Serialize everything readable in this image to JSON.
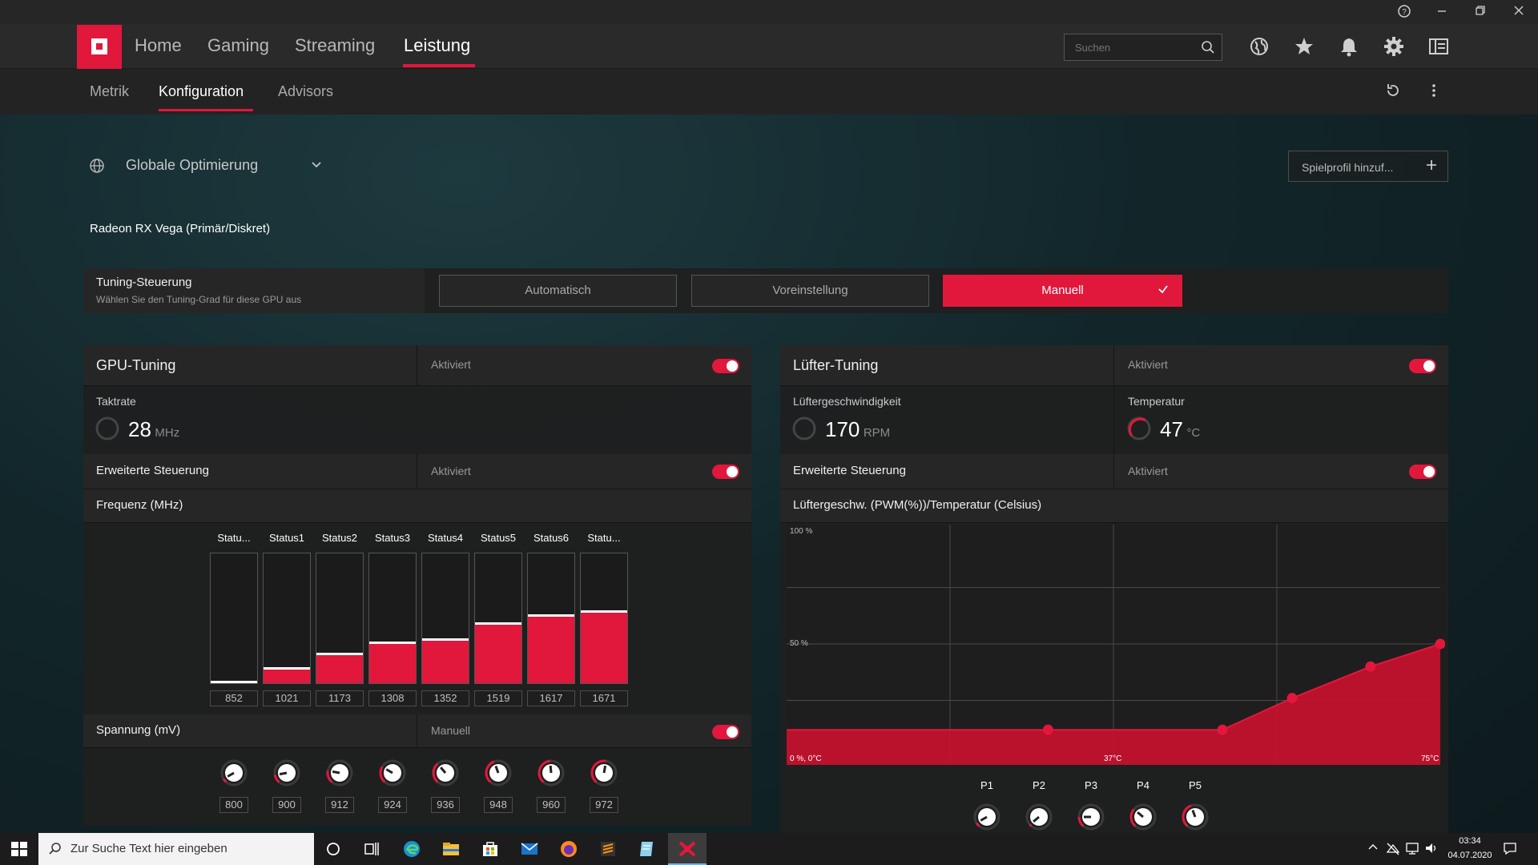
{
  "header": {
    "tabs": [
      {
        "label": "Home"
      },
      {
        "label": "Gaming"
      },
      {
        "label": "Streaming"
      },
      {
        "label": "Leistung",
        "active": true
      }
    ],
    "search_placeholder": "Suchen"
  },
  "subnav": {
    "tabs": [
      {
        "label": "Metrik"
      },
      {
        "label": "Konfiguration",
        "active": true
      },
      {
        "label": "Advisors"
      }
    ]
  },
  "profile": {
    "label": "Globale Optimierung",
    "add_button": "Spielprofil hinzuf...",
    "gpu_name": "Radeon RX Vega (Primär/Diskret)"
  },
  "tuning_control": {
    "title": "Tuning-Steuerung",
    "subtitle": "Wählen Sie den Tuning-Grad für diese GPU aus",
    "options": [
      "Automatisch",
      "Voreinstellung",
      "Manuell"
    ],
    "selected": "Manuell"
  },
  "gpu_tuning": {
    "title": "GPU-Tuning",
    "status": "Aktiviert",
    "clock_label": "Taktrate",
    "clock_value": "28",
    "clock_unit": "MHz",
    "advanced_label": "Erweiterte Steuerung",
    "advanced_status": "Aktiviert",
    "freq_label": "Frequenz (MHz)",
    "states": [
      {
        "name": "Statu...",
        "freq": "852",
        "level": 0.0,
        "voltage": "800"
      },
      {
        "name": "Status1",
        "freq": "1021",
        "level": 0.105,
        "voltage": "900"
      },
      {
        "name": "Status2",
        "freq": "1173",
        "level": 0.215,
        "voltage": "912"
      },
      {
        "name": "Status3",
        "freq": "1308",
        "level": 0.3,
        "voltage": "924"
      },
      {
        "name": "Status4",
        "freq": "1352",
        "level": 0.33,
        "voltage": "936"
      },
      {
        "name": "Status5",
        "freq": "1519",
        "level": 0.45,
        "voltage": "948"
      },
      {
        "name": "Status6",
        "freq": "1617",
        "level": 0.51,
        "voltage": "960"
      },
      {
        "name": "Statu...",
        "freq": "1671",
        "level": 0.545,
        "voltage": "972"
      }
    ],
    "voltage_label": "Spannung (mV)",
    "voltage_mode": "Manuell"
  },
  "fan_tuning": {
    "title": "Lüfter-Tuning",
    "status": "Aktiviert",
    "speed_label": "Lüftergeschwindigkeit",
    "speed_value": "170",
    "speed_unit": "RPM",
    "temp_label": "Temperatur",
    "temp_value": "47",
    "temp_unit": "°C",
    "advanced_label": "Erweiterte Steuerung",
    "advanced_status": "Aktiviert",
    "curve_label": "Lüftergeschw. (PWM(%))/Temperatur (Celsius)",
    "axis_top": "100 %",
    "axis_mid": "50 %",
    "axis_origin": "0 %, 0°C",
    "axis_mid_temp": "37°C",
    "axis_max_temp": "75°C",
    "points": [
      "P1",
      "P2",
      "P3",
      "P4",
      "P5"
    ]
  },
  "chart_data": {
    "type": "area",
    "title": "Lüftergeschw. (PWM(%))/Temperatur (Celsius)",
    "xlabel": "",
    "ylabel": "",
    "xlim": [
      0,
      75
    ],
    "ylim": [
      0,
      100
    ],
    "x": [
      30,
      50,
      58,
      67,
      75
    ],
    "series": [
      {
        "values": [
          12,
          12,
          26,
          40,
          50
        ]
      }
    ]
  },
  "taskbar": {
    "search_placeholder": "Zur Suche Text hier eingeben",
    "time": "03:34",
    "date": "04.07.2020"
  }
}
